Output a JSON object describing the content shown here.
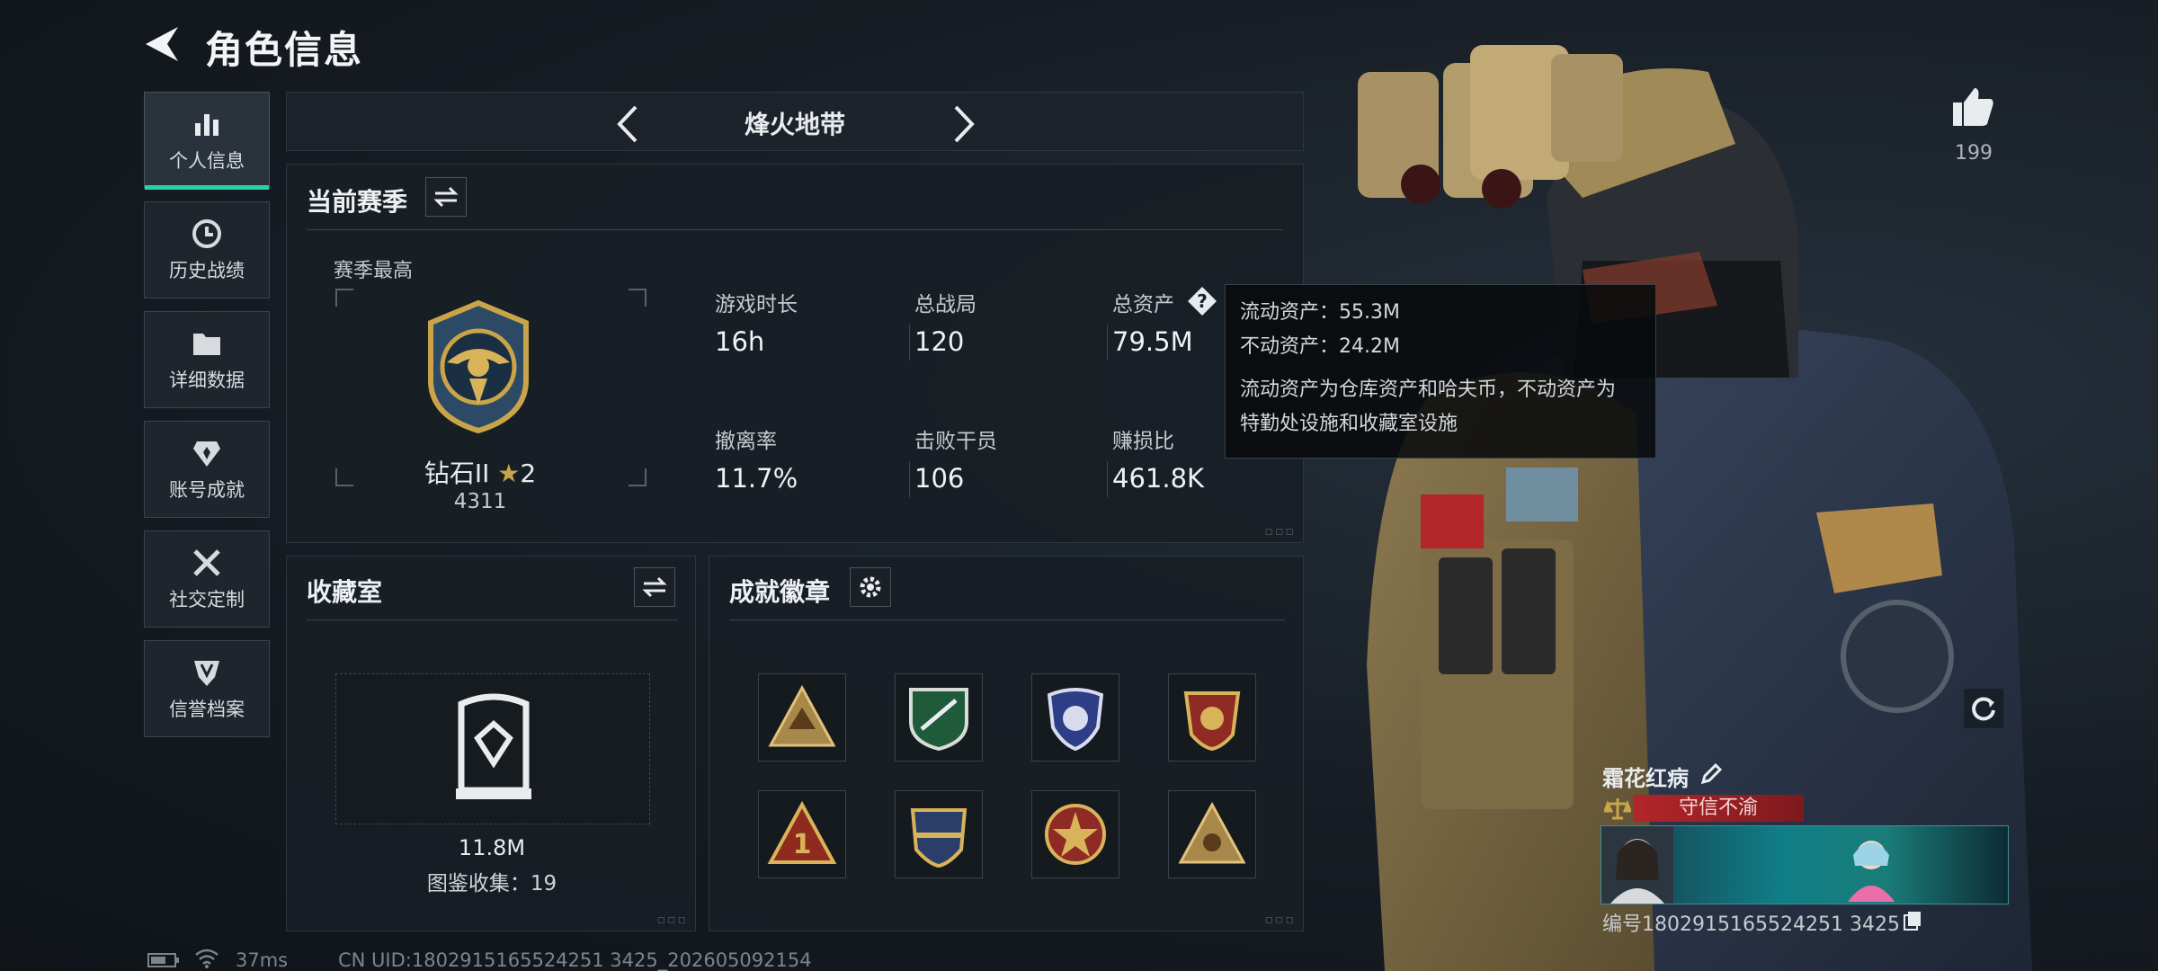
{
  "header": {
    "title": "角色信息"
  },
  "sidebar": {
    "items": [
      {
        "label": "个人信息",
        "icon": "bar-chart-icon",
        "active": true
      },
      {
        "label": "历史战绩",
        "icon": "clock-icon"
      },
      {
        "label": "详细数据",
        "icon": "folder-icon"
      },
      {
        "label": "账号成就",
        "icon": "achievement-icon"
      },
      {
        "label": "社交定制",
        "icon": "tools-icon"
      },
      {
        "label": "信誉档案",
        "icon": "shield-icon"
      }
    ]
  },
  "mode": {
    "title": "烽火地带"
  },
  "season": {
    "title": "当前赛季",
    "best_label": "赛季最高",
    "rank_name": "钻石II",
    "rank_stars": "2",
    "rank_points": "4311",
    "stats": [
      {
        "label": "游戏时长",
        "value": "16h"
      },
      {
        "label": "总战局",
        "value": "120"
      },
      {
        "label": "总资产",
        "value": "79.5M"
      },
      {
        "label": "撤离率",
        "value": "11.7%"
      },
      {
        "label": "击败干员",
        "value": "106"
      },
      {
        "label": "赚损比",
        "value": "461.8K"
      }
    ]
  },
  "tooltip": {
    "line1": "流动资产：55.3M",
    "line2": "不动资产：24.2M",
    "line3": "流动资产为仓库资产和哈夫币，不动资产为",
    "line4": "特勤处设施和收藏室设施"
  },
  "collection": {
    "title": "收藏室",
    "value": "11.8M",
    "count_label": "图鉴收集：19"
  },
  "badges": {
    "title": "成就徽章"
  },
  "profile": {
    "likes": "199",
    "name": "霜花红病",
    "motto": "守信不渝",
    "id_text": "编号1802915165524251 3425"
  },
  "status": {
    "ping": "37ms",
    "uid": "CN UID:1802915165524251 3425_202605092154"
  },
  "colors": {
    "accent": "#27d3a2",
    "gold": "#c9a449",
    "red_badge": "#b3262a"
  }
}
